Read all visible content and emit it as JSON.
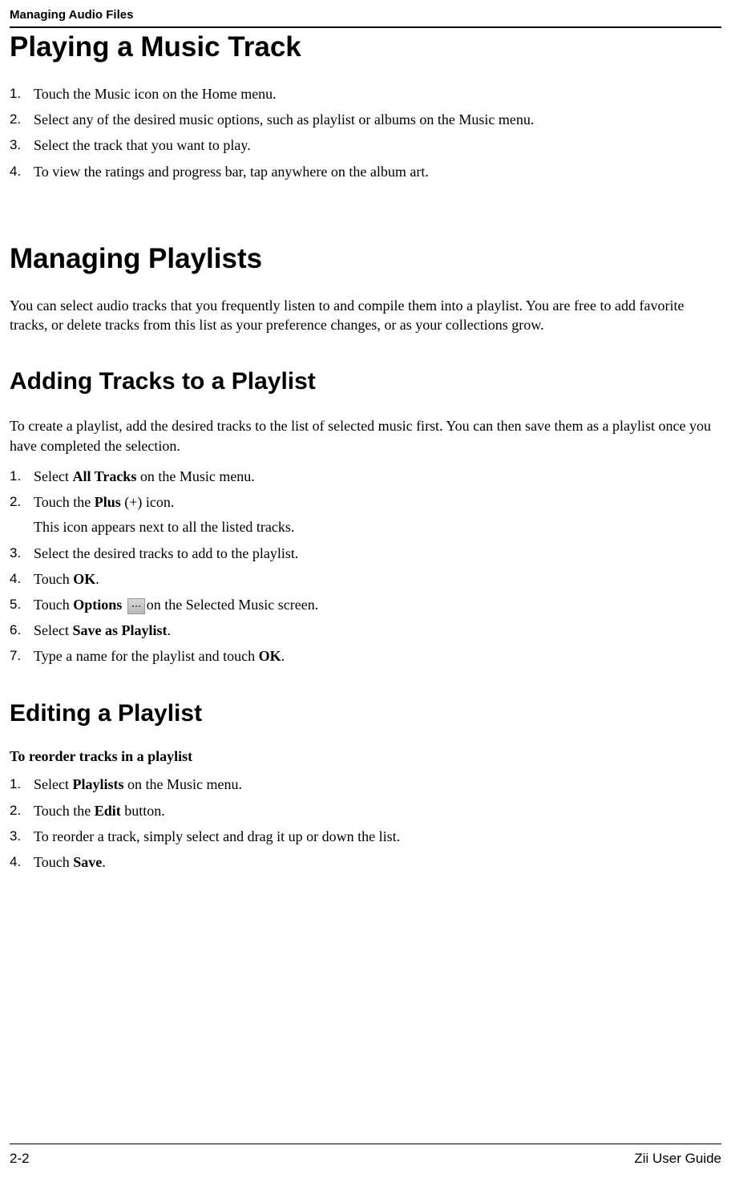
{
  "header": {
    "title": "Managing Audio Files"
  },
  "section1": {
    "heading": "Playing a Music Track",
    "steps": [
      "Touch the Music icon on the Home menu.",
      "Select any of the desired music options, such as playlist or albums on the Music menu.",
      "Select the track that you want to play.",
      "To view the ratings and progress bar, tap anywhere on the album art."
    ]
  },
  "section2": {
    "heading": "Managing Playlists",
    "intro": "You can select audio tracks that you frequently listen to and compile them into a playlist.  You are free to add favorite tracks, or delete tracks from this list as your preference changes, or as your collections grow."
  },
  "section3": {
    "heading": "Adding Tracks to a Playlist",
    "intro": "To create a playlist, add the desired tracks to the list of selected music first. You can then save them as a playlist once you have completed the selection.",
    "step1_prefix": "Select ",
    "step1_bold": "All Tracks",
    "step1_suffix": " on the Music menu.",
    "step2_prefix": "Touch the ",
    "step2_bold": "Plus",
    "step2_suffix": " (+) icon.",
    "step2_sub": "This icon appears next to all the listed tracks.",
    "step3": "Select the desired tracks to add to the playlist.",
    "step4_prefix": "Touch ",
    "step4_bold": "OK",
    "step4_suffix": ".",
    "step5_prefix": "Touch ",
    "step5_bold": "Options",
    "step5_suffix": "on the Selected Music screen.",
    "step6_prefix": "Select ",
    "step6_bold": "Save as Playlist",
    "step6_suffix": ".",
    "step7_prefix": "Type a name for the playlist and touch ",
    "step7_bold": "OK",
    "step7_suffix": "."
  },
  "section4": {
    "heading": "Editing a Playlist",
    "subheading": "To reorder tracks in a playlist",
    "step1_prefix": "Select ",
    "step1_bold": "Playlists",
    "step1_suffix": " on the Music menu.",
    "step2_prefix": "Touch the ",
    "step2_bold": "Edit",
    "step2_suffix": " button.",
    "step3": "To reorder a track, simply select and drag it up or down the list.",
    "step4_prefix": "Touch ",
    "step4_bold": "Save",
    "step4_suffix": "."
  },
  "footer": {
    "page": "2-2",
    "guide": "Zii User Guide"
  }
}
